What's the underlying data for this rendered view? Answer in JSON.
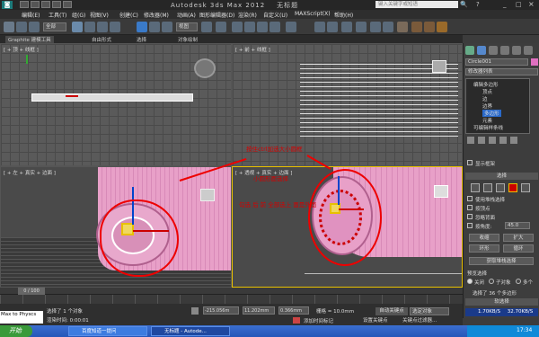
{
  "app": {
    "title": "Autodesk 3ds Max  2012",
    "doc": "无标题",
    "search_placeholder": "键入关键字或短语"
  },
  "menu": [
    "编辑(E)",
    "工具(T)",
    "组(G)",
    "视图(V)",
    "创建(C)",
    "修改器(M)",
    "动画(A)",
    "图形编辑器(D)",
    "渲染(R)",
    "自定义(U)",
    "MAXScript(X)",
    "帮助(H)"
  ],
  "toolbar": {
    "selection_filter": "全部",
    "view_dropdown": "视图"
  },
  "ribbon": {
    "tabs": [
      "Graphite 建模工具",
      "自由形式",
      "选择",
      "对象绘制"
    ]
  },
  "viewports": {
    "top": {
      "label": "[ + 顶 + 线框 ]"
    },
    "front": {
      "label": "[ + 前 + 线框 ]"
    },
    "left": {
      "label": "[ + 左 + 真实 + 边面 ]"
    },
    "persp": {
      "label": "[ + 透视 + 真实 + 边面 ]"
    }
  },
  "annotations": {
    "a1": "按住ctrl加选大小圆框",
    "a2": "小圆形面选择",
    "a3": "勾选 后 前 全部选上 面是外面"
  },
  "command_panel": {
    "object_name": "Circle001",
    "modifier_list": "修改器列表",
    "stack": [
      "编辑多边形",
      "顶点",
      "边",
      "边界",
      "多边形",
      "元素",
      "可编辑样条线"
    ],
    "rollout_select": "选择",
    "options": [
      "使用堆栈选择",
      "按顶点",
      "忽略背面",
      "按角度:"
    ],
    "angle_value": "45.0",
    "buttons": {
      "shrink": "收缩",
      "grow": "扩大",
      "ring": "环形",
      "loop": "循环"
    },
    "get_stack_selection": "获取堆栈选择",
    "preview_selection": "预览选择",
    "preview_options": [
      "关闭",
      "子对象",
      "多个"
    ],
    "selected_info": "选择了 36 个多边形",
    "soft_select": "软选择",
    "show_cage": "显示框架",
    "stats": [
      "1.70KB/S",
      "32.70KB/S"
    ]
  },
  "status": {
    "frame": "0 / 100",
    "selected": "选择了 1 个对象",
    "rendering_time": "渲染时间: 0:00:01",
    "x": "-215.056m",
    "y": "11.202mm",
    "z": "0.366mm",
    "grid": "栅格 = 10.0mm",
    "add_time_tag": "添加时间标记",
    "auto_key": "自动关键点",
    "selected_object": "选定对象",
    "set_key": "设置关键点",
    "key_filter": "关键点过滤器...",
    "script_prompt": "Max to Physcs"
  },
  "taskbar": {
    "start": "开始",
    "items": [
      "百度知道一提问",
      "无标题 - Autode..."
    ],
    "clock": "17:34"
  }
}
